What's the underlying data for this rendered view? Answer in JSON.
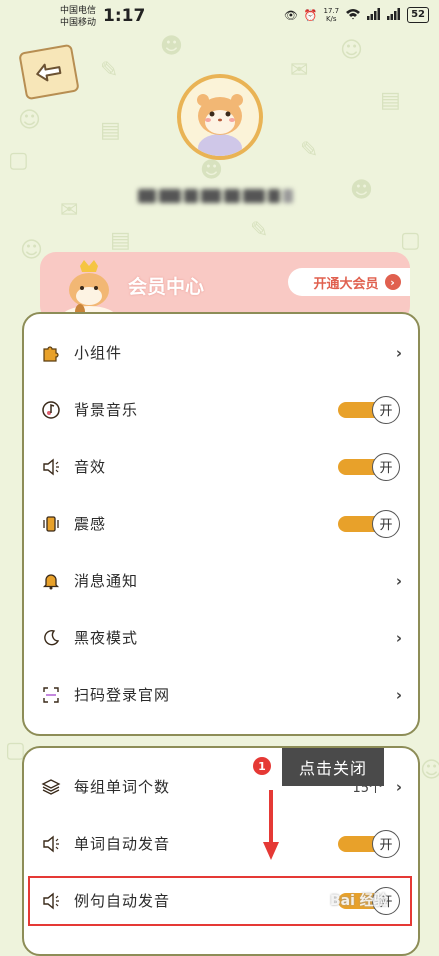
{
  "status_bar": {
    "carrier_1": "中国电信",
    "carrier_2": "中国移动",
    "time": "1:17",
    "speed_value": "17.7",
    "speed_unit": "K/s",
    "battery": "52"
  },
  "vip": {
    "title": "会员中心",
    "button_label": "开通大会员"
  },
  "settings_group_1": [
    {
      "label": "小组件",
      "icon": "puzzle-icon",
      "control": "chevron"
    },
    {
      "label": "背景音乐",
      "icon": "music-icon",
      "control": "toggle",
      "state_label": "开"
    },
    {
      "label": "音效",
      "icon": "speaker-icon",
      "control": "toggle",
      "state_label": "开"
    },
    {
      "label": "震感",
      "icon": "vibrate-icon",
      "control": "toggle",
      "state_label": "开"
    },
    {
      "label": "消息通知",
      "icon": "bell-icon",
      "control": "chevron"
    },
    {
      "label": "黑夜模式",
      "icon": "moon-icon",
      "control": "chevron"
    },
    {
      "label": "扫码登录官网",
      "icon": "scan-icon",
      "control": "chevron"
    }
  ],
  "settings_group_2": [
    {
      "label": "每组单词个数",
      "icon": "layers-icon",
      "control": "chevron",
      "value": "15个"
    },
    {
      "label": "单词自动发音",
      "icon": "speaker-icon",
      "control": "toggle",
      "state_label": "开"
    },
    {
      "label": "例句自动发音",
      "icon": "speaker-icon",
      "control": "toggle",
      "state_label": "开"
    }
  ],
  "annotation": {
    "step_number": "1",
    "tooltip": "点击关闭",
    "watermark": "Bai 经验"
  },
  "colors": {
    "background": "#eef3dc",
    "accent": "#e8a12a",
    "card_border": "#8d8d57",
    "vip_card": "#f9c9c4",
    "highlight": "#e53935"
  }
}
